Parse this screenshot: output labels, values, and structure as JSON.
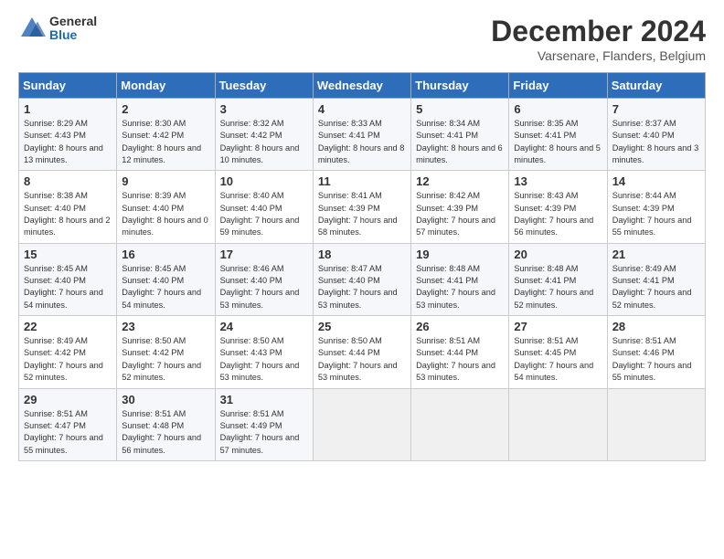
{
  "header": {
    "logo_general": "General",
    "logo_blue": "Blue",
    "month_title": "December 2024",
    "location": "Varsenare, Flanders, Belgium"
  },
  "days_of_week": [
    "Sunday",
    "Monday",
    "Tuesday",
    "Wednesday",
    "Thursday",
    "Friday",
    "Saturday"
  ],
  "weeks": [
    [
      {
        "num": "1",
        "sunrise": "Sunrise: 8:29 AM",
        "sunset": "Sunset: 4:43 PM",
        "daylight": "Daylight: 8 hours and 13 minutes."
      },
      {
        "num": "2",
        "sunrise": "Sunrise: 8:30 AM",
        "sunset": "Sunset: 4:42 PM",
        "daylight": "Daylight: 8 hours and 12 minutes."
      },
      {
        "num": "3",
        "sunrise": "Sunrise: 8:32 AM",
        "sunset": "Sunset: 4:42 PM",
        "daylight": "Daylight: 8 hours and 10 minutes."
      },
      {
        "num": "4",
        "sunrise": "Sunrise: 8:33 AM",
        "sunset": "Sunset: 4:41 PM",
        "daylight": "Daylight: 8 hours and 8 minutes."
      },
      {
        "num": "5",
        "sunrise": "Sunrise: 8:34 AM",
        "sunset": "Sunset: 4:41 PM",
        "daylight": "Daylight: 8 hours and 6 minutes."
      },
      {
        "num": "6",
        "sunrise": "Sunrise: 8:35 AM",
        "sunset": "Sunset: 4:41 PM",
        "daylight": "Daylight: 8 hours and 5 minutes."
      },
      {
        "num": "7",
        "sunrise": "Sunrise: 8:37 AM",
        "sunset": "Sunset: 4:40 PM",
        "daylight": "Daylight: 8 hours and 3 minutes."
      }
    ],
    [
      {
        "num": "8",
        "sunrise": "Sunrise: 8:38 AM",
        "sunset": "Sunset: 4:40 PM",
        "daylight": "Daylight: 8 hours and 2 minutes."
      },
      {
        "num": "9",
        "sunrise": "Sunrise: 8:39 AM",
        "sunset": "Sunset: 4:40 PM",
        "daylight": "Daylight: 8 hours and 0 minutes."
      },
      {
        "num": "10",
        "sunrise": "Sunrise: 8:40 AM",
        "sunset": "Sunset: 4:40 PM",
        "daylight": "Daylight: 7 hours and 59 minutes."
      },
      {
        "num": "11",
        "sunrise": "Sunrise: 8:41 AM",
        "sunset": "Sunset: 4:39 PM",
        "daylight": "Daylight: 7 hours and 58 minutes."
      },
      {
        "num": "12",
        "sunrise": "Sunrise: 8:42 AM",
        "sunset": "Sunset: 4:39 PM",
        "daylight": "Daylight: 7 hours and 57 minutes."
      },
      {
        "num": "13",
        "sunrise": "Sunrise: 8:43 AM",
        "sunset": "Sunset: 4:39 PM",
        "daylight": "Daylight: 7 hours and 56 minutes."
      },
      {
        "num": "14",
        "sunrise": "Sunrise: 8:44 AM",
        "sunset": "Sunset: 4:39 PM",
        "daylight": "Daylight: 7 hours and 55 minutes."
      }
    ],
    [
      {
        "num": "15",
        "sunrise": "Sunrise: 8:45 AM",
        "sunset": "Sunset: 4:40 PM",
        "daylight": "Daylight: 7 hours and 54 minutes."
      },
      {
        "num": "16",
        "sunrise": "Sunrise: 8:45 AM",
        "sunset": "Sunset: 4:40 PM",
        "daylight": "Daylight: 7 hours and 54 minutes."
      },
      {
        "num": "17",
        "sunrise": "Sunrise: 8:46 AM",
        "sunset": "Sunset: 4:40 PM",
        "daylight": "Daylight: 7 hours and 53 minutes."
      },
      {
        "num": "18",
        "sunrise": "Sunrise: 8:47 AM",
        "sunset": "Sunset: 4:40 PM",
        "daylight": "Daylight: 7 hours and 53 minutes."
      },
      {
        "num": "19",
        "sunrise": "Sunrise: 8:48 AM",
        "sunset": "Sunset: 4:41 PM",
        "daylight": "Daylight: 7 hours and 53 minutes."
      },
      {
        "num": "20",
        "sunrise": "Sunrise: 8:48 AM",
        "sunset": "Sunset: 4:41 PM",
        "daylight": "Daylight: 7 hours and 52 minutes."
      },
      {
        "num": "21",
        "sunrise": "Sunrise: 8:49 AM",
        "sunset": "Sunset: 4:41 PM",
        "daylight": "Daylight: 7 hours and 52 minutes."
      }
    ],
    [
      {
        "num": "22",
        "sunrise": "Sunrise: 8:49 AM",
        "sunset": "Sunset: 4:42 PM",
        "daylight": "Daylight: 7 hours and 52 minutes."
      },
      {
        "num": "23",
        "sunrise": "Sunrise: 8:50 AM",
        "sunset": "Sunset: 4:42 PM",
        "daylight": "Daylight: 7 hours and 52 minutes."
      },
      {
        "num": "24",
        "sunrise": "Sunrise: 8:50 AM",
        "sunset": "Sunset: 4:43 PM",
        "daylight": "Daylight: 7 hours and 53 minutes."
      },
      {
        "num": "25",
        "sunrise": "Sunrise: 8:50 AM",
        "sunset": "Sunset: 4:44 PM",
        "daylight": "Daylight: 7 hours and 53 minutes."
      },
      {
        "num": "26",
        "sunrise": "Sunrise: 8:51 AM",
        "sunset": "Sunset: 4:44 PM",
        "daylight": "Daylight: 7 hours and 53 minutes."
      },
      {
        "num": "27",
        "sunrise": "Sunrise: 8:51 AM",
        "sunset": "Sunset: 4:45 PM",
        "daylight": "Daylight: 7 hours and 54 minutes."
      },
      {
        "num": "28",
        "sunrise": "Sunrise: 8:51 AM",
        "sunset": "Sunset: 4:46 PM",
        "daylight": "Daylight: 7 hours and 55 minutes."
      }
    ],
    [
      {
        "num": "29",
        "sunrise": "Sunrise: 8:51 AM",
        "sunset": "Sunset: 4:47 PM",
        "daylight": "Daylight: 7 hours and 55 minutes."
      },
      {
        "num": "30",
        "sunrise": "Sunrise: 8:51 AM",
        "sunset": "Sunset: 4:48 PM",
        "daylight": "Daylight: 7 hours and 56 minutes."
      },
      {
        "num": "31",
        "sunrise": "Sunrise: 8:51 AM",
        "sunset": "Sunset: 4:49 PM",
        "daylight": "Daylight: 7 hours and 57 minutes."
      },
      null,
      null,
      null,
      null
    ]
  ]
}
